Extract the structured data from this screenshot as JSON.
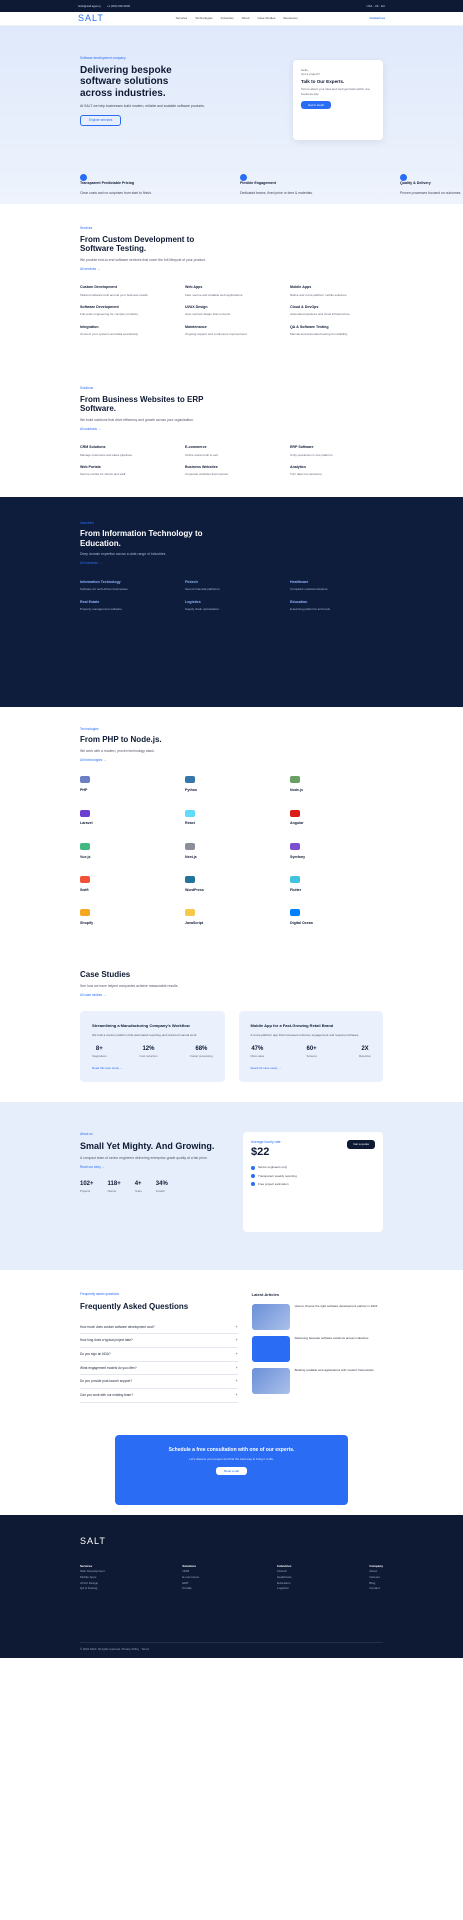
{
  "topbar": {
    "email": "hello@salt.agency",
    "phone": "+1 (000) 000-0000",
    "offices": "USA · UK · EU"
  },
  "nav": {
    "logo": "SALT",
    "links": [
      "Services",
      "Technologies",
      "Industries",
      "About",
      "Case Studies",
      "Resources"
    ],
    "cta": "Contact us"
  },
  "hero": {
    "eyebrow": "Software development company",
    "title": "Delivering bespoke software solutions across industries.",
    "text": "At SALT we help businesses build modern, reliable and scalable software products.",
    "button": "Explore services",
    "card": {
      "small": "Hello,",
      "question": "Got a project?",
      "title": "Talk to Our Experts.",
      "text": "Tell us about your idea and we'll get back within one business day.",
      "button": "Get in touch"
    },
    "features": [
      {
        "title": "Transparent Predictable Pricing",
        "text": "Clear costs and no surprises from start to finish."
      },
      {
        "title": "Flexible Engagement",
        "text": "Dedicated teams, fixed price or time & materials."
      },
      {
        "title": "Quality & Delivery",
        "text": "Proven processes focused on outcomes."
      }
    ]
  },
  "services": {
    "eyebrow": "Services",
    "title": "From Custom Development to Software Testing.",
    "lead": "We provide end-to-end software services that cover the full lifecycle of your product.",
    "more": "All services →",
    "items": [
      {
        "t": "Custom Development",
        "d": "Tailored software built around your business needs."
      },
      {
        "t": "Web Apps",
        "d": "Fast, secure and scalable web applications."
      },
      {
        "t": "Mobile Apps",
        "d": "Native and cross-platform mobile solutions."
      },
      {
        "t": "Software Development",
        "d": "Full-cycle engineering for complex products."
      },
      {
        "t": "UI/UX Design",
        "d": "User-centred design that converts."
      },
      {
        "t": "Cloud & DevOps",
        "d": "Automated pipelines and cloud infrastructure."
      },
      {
        "t": "Integration",
        "d": "Connect your systems and data seamlessly."
      },
      {
        "t": "Maintenance",
        "d": "Ongoing support and continuous improvement."
      },
      {
        "t": "QA & Software Testing",
        "d": "Manual and automated testing for reliability."
      }
    ]
  },
  "solutions": {
    "eyebrow": "Solutions",
    "title": "From Business Websites to ERP Software.",
    "lead": "We build solutions that drive efficiency and growth across your organisation.",
    "more": "All solutions →",
    "items": [
      {
        "t": "CRM Solutions",
        "d": "Manage customers and sales pipelines."
      },
      {
        "t": "E-commerce",
        "d": "Online stores built to sell."
      },
      {
        "t": "ERP Software",
        "d": "Unify operations in one platform."
      },
      {
        "t": "Web Portals",
        "d": "Secure portals for clients and staff."
      },
      {
        "t": "Business Websites",
        "d": "Corporate websites that impress."
      },
      {
        "t": "Analytics",
        "d": "Turn data into decisions."
      }
    ]
  },
  "industries": {
    "eyebrow": "Industries",
    "title": "From Information Technology to Education.",
    "lead": "Deep domain expertise across a wide range of industries.",
    "more": "All industries →",
    "items": [
      {
        "t": "Information Technology",
        "d": "Software for tech-driven businesses."
      },
      {
        "t": "Fintech",
        "d": "Secure financial platforms."
      },
      {
        "t": "Healthcare",
        "d": "Compliant medical solutions."
      },
      {
        "t": "Real Estate",
        "d": "Property management software."
      },
      {
        "t": "Logistics",
        "d": "Supply chain optimisation."
      },
      {
        "t": "Education",
        "d": "E-learning platforms and tools."
      }
    ]
  },
  "tech": {
    "eyebrow": "Technologies",
    "title": "From PHP to Node.js.",
    "lead": "We work with a modern, proven technology stack.",
    "more": "All technologies →",
    "items": [
      {
        "t": "PHP",
        "c": "#6d7fc4"
      },
      {
        "t": "Python",
        "c": "#3776ab"
      },
      {
        "t": "Node.js",
        "c": "#68a063"
      },
      {
        "t": "Laravel",
        "c": "#6a3fd1"
      },
      {
        "t": "React",
        "c": "#61dafb"
      },
      {
        "t": "Angular",
        "c": "#dd1b16"
      },
      {
        "t": "Vue.js",
        "c": "#42b883"
      },
      {
        "t": "Next.js",
        "c": "#8a8f99"
      },
      {
        "t": "Symfony",
        "c": "#7b4fd1"
      },
      {
        "t": "Swift",
        "c": "#f05138"
      },
      {
        "t": "WordPress",
        "c": "#21759b"
      },
      {
        "t": "Flutter",
        "c": "#41c4e0"
      },
      {
        "t": "Shopify",
        "c": "#f5a623"
      },
      {
        "t": "JavaScript",
        "c": "#f7c948"
      },
      {
        "t": "Digital Ocean",
        "c": "#0080ff"
      }
    ]
  },
  "cases": {
    "title": "Case Studies",
    "lead": "See how we have helped companies achieve measurable results.",
    "more": "All case studies →",
    "items": [
      {
        "t": "Streamlining a Manufacturing Company's Workflow",
        "p": "We built a custom platform that automated reporting and reduced manual work.",
        "stats": [
          {
            "v": "8+",
            "l": "Integrations"
          },
          {
            "v": "12%",
            "l": "Cost reduction"
          },
          {
            "v": "68%",
            "l": "Faster processing"
          }
        ],
        "link": "Read full case study →"
      },
      {
        "t": "Mobile App for a Fast-Growing Retail Brand",
        "p": "A cross-platform app that increased customer engagement and repeat purchases.",
        "stats": [
          {
            "v": "47%",
            "l": "More sales"
          },
          {
            "v": "60+",
            "l": "Screens"
          },
          {
            "v": "2X",
            "l": "Retention"
          }
        ],
        "link": "Read full case study →"
      }
    ]
  },
  "mighty": {
    "eyebrow": "About us",
    "title": "Small Yet Mighty. And Growing.",
    "text": "A compact team of senior engineers delivering enterprise-grade quality at a fair price.",
    "more": "Read our story →",
    "stats": [
      {
        "v": "102+",
        "l": "Projects"
      },
      {
        "v": "118+",
        "l": "Clients"
      },
      {
        "v": "4+",
        "l": "Years"
      },
      {
        "v": "34%",
        "l": "Growth"
      }
    ],
    "rate": {
      "label": "Average hourly rate",
      "price": "$22",
      "tag": "Get a quote",
      "items": [
        "Senior engineers only",
        "Transparent weekly reporting",
        "Free project estimation"
      ]
    }
  },
  "faq": {
    "eyebrow": "Frequently asked questions",
    "title": "Frequently Asked Questions",
    "items": [
      "How much does custom software development cost?",
      "How long does a typical project take?",
      "Do you sign an NDA?",
      "What engagement models do you offer?",
      "Do you provide post-launch support?",
      "Can you work with our existing team?"
    ],
    "articles_title": "Latest Articles",
    "articles": [
      {
        "t": "How to choose the right software development partner in 2024"
      },
      {
        "t": "Delivering bespoke software solutions across industries"
      },
      {
        "t": "Building scalable web applications with modern frameworks"
      }
    ]
  },
  "cta": {
    "title": "Schedule a free consultation with one of our experts.",
    "text": "Let's discuss your project and find the best way to bring it to life.",
    "button": "Book a call"
  },
  "footer": {
    "logo": "SALT",
    "cols": [
      {
        "h": "Services",
        "i": [
          "Web Development",
          "Mobile Apps",
          "UI/UX Design",
          "QA & Testing"
        ]
      },
      {
        "h": "Solutions",
        "i": [
          "CRM",
          "E-commerce",
          "ERP",
          "Portals"
        ]
      },
      {
        "h": "Industries",
        "i": [
          "Fintech",
          "Healthcare",
          "Education",
          "Logistics"
        ]
      },
      {
        "h": "Company",
        "i": [
          "About",
          "Careers",
          "Blog",
          "Contact"
        ]
      }
    ],
    "copy": "© 2024 SALT. All rights reserved. Privacy Policy · Terms"
  }
}
